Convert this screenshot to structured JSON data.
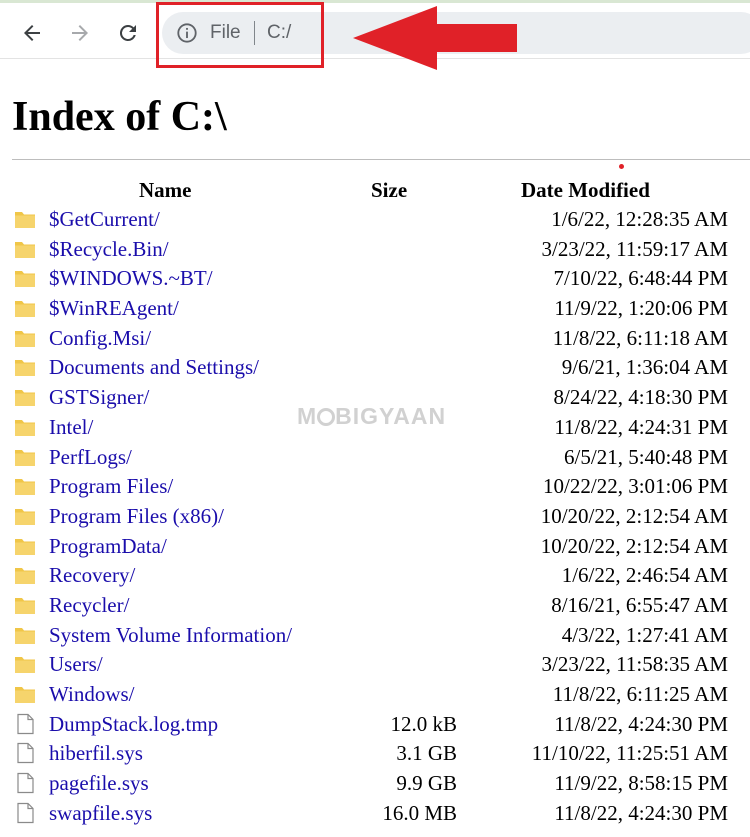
{
  "browser": {
    "back_icon": "arrow-left-icon",
    "forward_icon": "arrow-right-icon",
    "reload_icon": "reload-icon",
    "info_icon": "info-circle-icon",
    "address_scheme": "File",
    "address_url": "C:/",
    "annotation_color": "#e02128"
  },
  "page": {
    "title": "Index of C:\\",
    "link_color": "#1a0dab"
  },
  "table": {
    "headers": {
      "name": "Name",
      "size": "Size",
      "date": "Date Modified"
    },
    "rows": [
      {
        "type": "folder",
        "name": "$GetCurrent/",
        "size": "",
        "date": "1/6/22, 12:28:35 AM"
      },
      {
        "type": "folder",
        "name": "$Recycle.Bin/",
        "size": "",
        "date": "3/23/22, 11:59:17 AM"
      },
      {
        "type": "folder",
        "name": "$WINDOWS.~BT/",
        "size": "",
        "date": "7/10/22, 6:48:44 PM"
      },
      {
        "type": "folder",
        "name": "$WinREAgent/",
        "size": "",
        "date": "11/9/22, 1:20:06 PM"
      },
      {
        "type": "folder",
        "name": "Config.Msi/",
        "size": "",
        "date": "11/8/22, 6:11:18 AM"
      },
      {
        "type": "folder",
        "name": "Documents and Settings/",
        "size": "",
        "date": "9/6/21, 1:36:04 AM"
      },
      {
        "type": "folder",
        "name": "GSTSigner/",
        "size": "",
        "date": "8/24/22, 4:18:30 PM"
      },
      {
        "type": "folder",
        "name": "Intel/",
        "size": "",
        "date": "11/8/22, 4:24:31 PM"
      },
      {
        "type": "folder",
        "name": "PerfLogs/",
        "size": "",
        "date": "6/5/21, 5:40:48 PM"
      },
      {
        "type": "folder",
        "name": "Program Files/",
        "size": "",
        "date": "10/22/22, 3:01:06 PM"
      },
      {
        "type": "folder",
        "name": "Program Files (x86)/",
        "size": "",
        "date": "10/20/22, 2:12:54 AM"
      },
      {
        "type": "folder",
        "name": "ProgramData/",
        "size": "",
        "date": "10/20/22, 2:12:54 AM"
      },
      {
        "type": "folder",
        "name": "Recovery/",
        "size": "",
        "date": "1/6/22, 2:46:54 AM"
      },
      {
        "type": "folder",
        "name": "Recycler/",
        "size": "",
        "date": "8/16/21, 6:55:47 AM"
      },
      {
        "type": "folder",
        "name": "System Volume Information/",
        "size": "",
        "date": "4/3/22, 1:27:41 AM"
      },
      {
        "type": "folder",
        "name": "Users/",
        "size": "",
        "date": "3/23/22, 11:58:35 AM"
      },
      {
        "type": "folder",
        "name": "Windows/",
        "size": "",
        "date": "11/8/22, 6:11:25 AM"
      },
      {
        "type": "file",
        "name": "DumpStack.log.tmp",
        "size": "12.0 kB",
        "date": "11/8/22, 4:24:30 PM"
      },
      {
        "type": "file",
        "name": "hiberfil.sys",
        "size": "3.1 GB",
        "date": "11/10/22, 11:25:51 AM"
      },
      {
        "type": "file",
        "name": "pagefile.sys",
        "size": "9.9 GB",
        "date": "11/9/22, 8:58:15 PM"
      },
      {
        "type": "file",
        "name": "swapfile.sys",
        "size": "16.0 MB",
        "date": "11/8/22, 4:24:30 PM"
      }
    ]
  },
  "watermark": {
    "brand": "MOBIGYAAN"
  }
}
